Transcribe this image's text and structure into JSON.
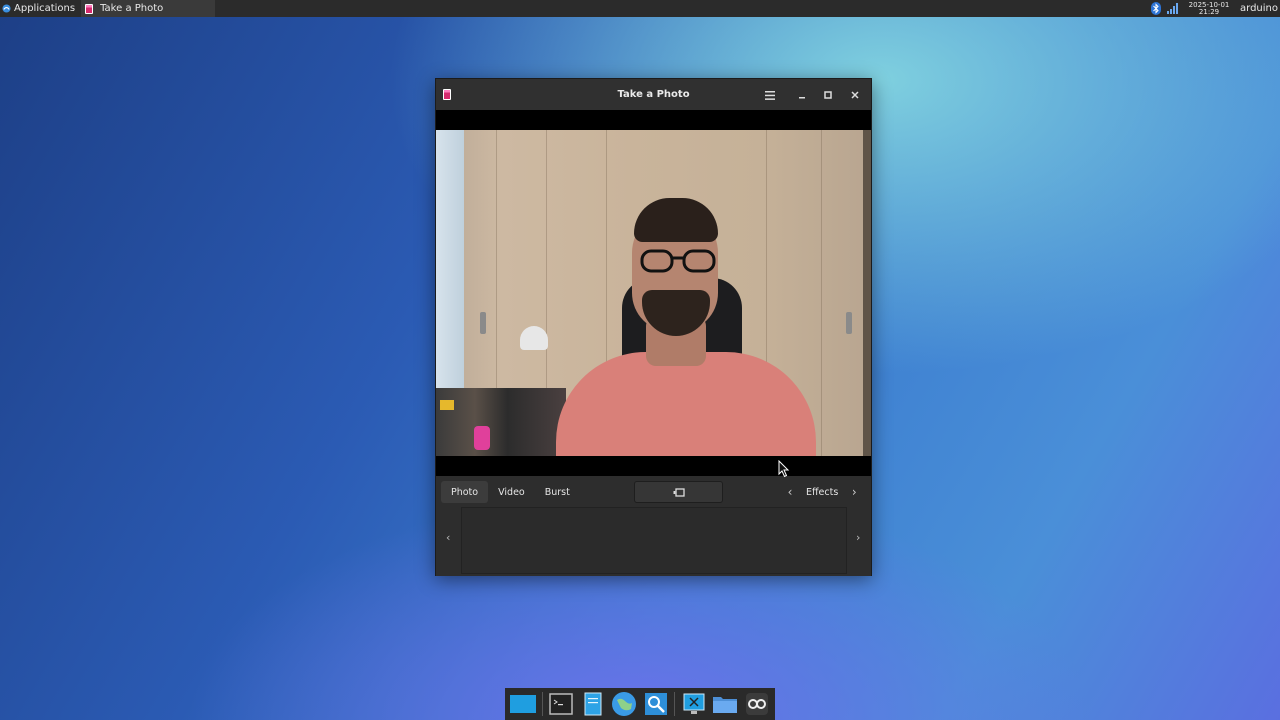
{
  "top_panel": {
    "applications_label": "Applications",
    "task_title": "Take a Photo",
    "clock_date": "2025-10-01",
    "clock_time": "21:29",
    "user": "arduino"
  },
  "window": {
    "title": "Take a Photo",
    "modes": [
      "Photo",
      "Video",
      "Burst"
    ],
    "active_mode": "Photo",
    "effects_label": "Effects"
  },
  "dock": {
    "items": [
      "show-desktop",
      "terminal",
      "text-editor",
      "web-browser",
      "app-finder",
      "xfce-settings",
      "file-manager",
      "arduino-ide"
    ]
  },
  "colors": {
    "panel": "#2b2b2b",
    "window_bg": "#2a2a2a",
    "titlebar": "#303030",
    "accent": "#2d74d6"
  }
}
